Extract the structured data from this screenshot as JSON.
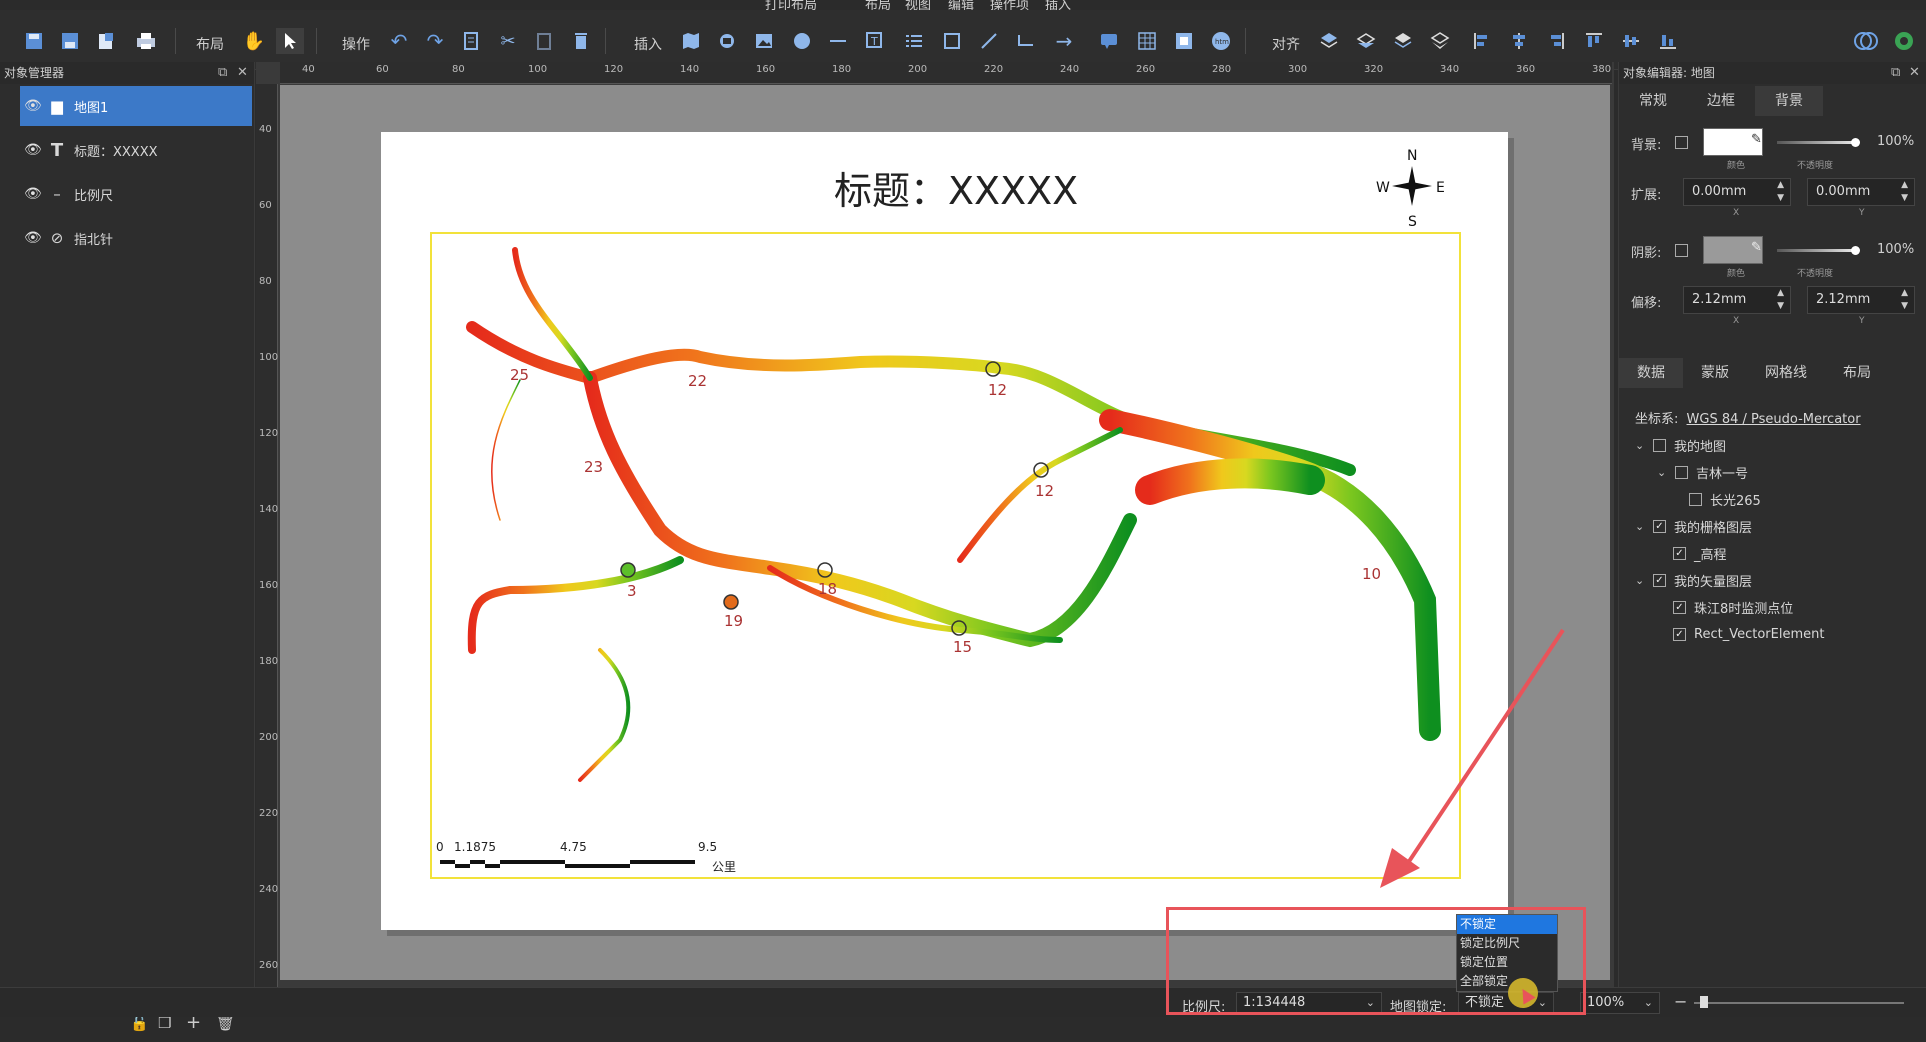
{
  "titlebar": {
    "title": "打印布局",
    "menu": [
      "布局",
      "视图",
      "编辑",
      "操作项",
      "插入"
    ]
  },
  "toolbar": {
    "layout_label": "布局",
    "operate_label": "操作",
    "insert_label": "插入",
    "align_label": "对齐"
  },
  "left_panel": {
    "title": "对象管理器",
    "items": [
      {
        "label": "地图1",
        "icon": "folder-icon"
      },
      {
        "label": "标题：XXXXX",
        "icon": "text-icon"
      },
      {
        "label": "比例尺",
        "icon": "scalebar-icon"
      },
      {
        "label": "指北针",
        "icon": "compass-icon"
      }
    ]
  },
  "ruler": {
    "h_ticks": [
      "40",
      "60",
      "80",
      "100",
      "120",
      "140",
      "160",
      "180",
      "200",
      "220",
      "240",
      "260",
      "280",
      "300",
      "320",
      "340",
      "360",
      "380"
    ],
    "v_ticks": [
      "40",
      "60",
      "80",
      "100",
      "120",
      "140",
      "160",
      "180",
      "200",
      "220",
      "240",
      "260"
    ]
  },
  "map": {
    "title": "标题：XXXXX",
    "compass": {
      "n": "N",
      "s": "S",
      "e": "E",
      "w": "W"
    },
    "points": [
      "25",
      "22",
      "12",
      "23",
      "12",
      "3",
      "18",
      "19",
      "15",
      "10"
    ],
    "scalebar": {
      "labels": [
        "0",
        "1.1875",
        "4.75",
        "9.5"
      ],
      "unit": "公里"
    }
  },
  "right_panel": {
    "title": "对象编辑器: 地图",
    "tabs": [
      "常规",
      "边框",
      "背景"
    ],
    "active_tab": "背景",
    "background": {
      "label": "背景:",
      "color_sub": "颜色",
      "opacity": "100%",
      "opacity_sub": "不透明度"
    },
    "expand": {
      "label": "扩展:",
      "x": "0.00mm",
      "y": "0.00mm",
      "x_sub": "X",
      "y_sub": "Y"
    },
    "shadow": {
      "label": "阴影:",
      "color_sub": "颜色",
      "opacity": "100%",
      "opacity_sub": "不透明度"
    },
    "offset": {
      "label": "偏移:",
      "x": "2.12mm",
      "y": "2.12mm",
      "x_sub": "X",
      "y_sub": "Y"
    },
    "tabs2": [
      "数据",
      "蒙版",
      "网格线",
      "布局"
    ],
    "crs_label": "坐标系:",
    "crs_value": "WGS 84 / Pseudo-Mercator",
    "layers": [
      {
        "label": "我的地图",
        "level": 0,
        "chev": "⌄",
        "checked": false
      },
      {
        "label": "吉林一号",
        "level": 1,
        "chev": "⌄",
        "checked": false
      },
      {
        "label": "长光265",
        "level": 2,
        "chev": "",
        "checked": false
      },
      {
        "label": "我的栅格图层",
        "level": 0,
        "chev": "⌄",
        "checked": true
      },
      {
        "label": "_高程",
        "level": 1,
        "chev": "",
        "checked": true
      },
      {
        "label": "我的矢量图层",
        "level": 0,
        "chev": "⌄",
        "checked": true
      },
      {
        "label": "珠江8时监测点位",
        "level": 1,
        "chev": "",
        "checked": true
      },
      {
        "label": "Rect_VectorElement",
        "level": 1,
        "chev": "",
        "checked": true
      }
    ]
  },
  "statusbar": {
    "scale_label": "比例尺:",
    "scale_value": "1:134448",
    "lock_label": "地图锁定:",
    "lock_value": "不锁定",
    "zoom_value": "100%"
  },
  "lock_dropdown": {
    "options": [
      "不锁定",
      "锁定比例尺",
      "锁定位置",
      "全部锁定"
    ],
    "selected": "不锁定"
  },
  "colors": {
    "accent": "#3c79c8",
    "highlight": "#e8545a",
    "frame": "#f2e23a"
  }
}
